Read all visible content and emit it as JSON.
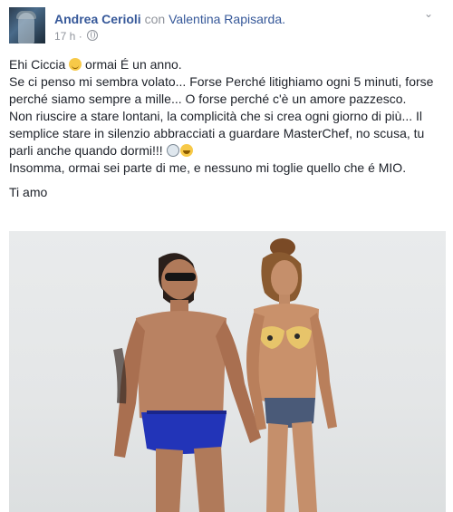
{
  "post": {
    "author": "Andrea Cerioli",
    "with_word": "con",
    "tagged": "Valentina Rapisarda.",
    "time": "17 h",
    "separator": "·",
    "menu_icon": "chevron-down-icon",
    "privacy_icon": "globe-icon",
    "text": {
      "line1_a": "Ehi Ciccia ",
      "line1_b": " ormai É un anno.",
      "para1": "Se ci penso mi sembra volato... Forse Perché litighiamo ogni 5 minuti, forse perché siamo sempre a mille... O forse perché c'è un amore pazzesco.",
      "para2": "Non riuscire a stare lontani, la complicità che si crea ogni giorno di più... Il semplice stare in silenzio abbracciati a guardare MasterChef, no scusa, tu parli anche quando dormi!!! ",
      "para3": "Insomma, ormai sei parte di me, e nessuno mi toglie quello che é MIO.",
      "closing": "Ti amo"
    }
  }
}
